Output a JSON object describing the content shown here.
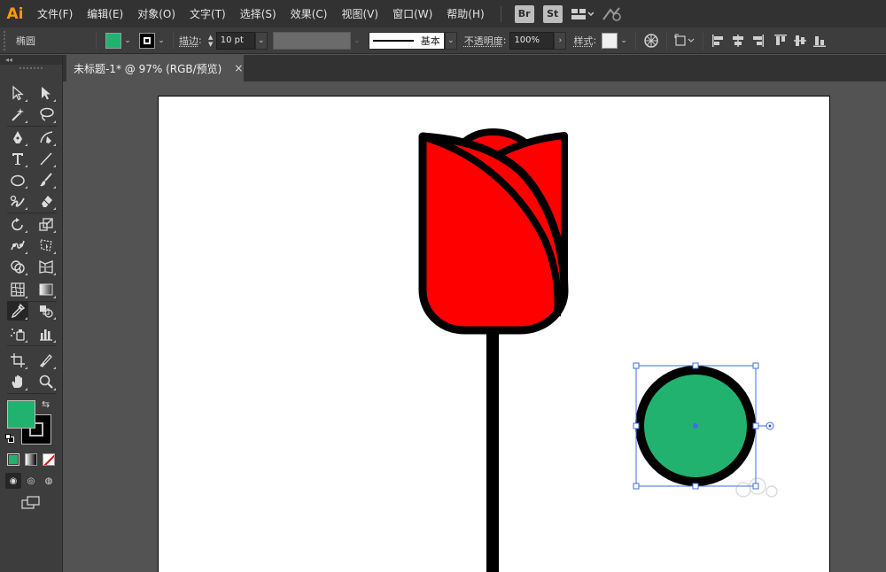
{
  "app": {
    "logo": "Ai"
  },
  "menubar": {
    "items": [
      "文件(F)",
      "编辑(E)",
      "对象(O)",
      "文字(T)",
      "选择(S)",
      "效果(C)",
      "视图(V)",
      "窗口(W)",
      "帮助(H)"
    ],
    "bridge": "Br",
    "stock": "St"
  },
  "controlbar": {
    "object_type": "椭圆",
    "fill_color": "#22b26f",
    "stroke_color": "#000000",
    "stroke_label": "描边",
    "stroke_weight": "10 pt",
    "profile_label": "基本",
    "opacity_label": "不透明度",
    "opacity_value": "100%",
    "style_label": "样式"
  },
  "toolbar": {
    "fill_color": "#22b26f",
    "stroke_color": "#000000",
    "tools": [
      [
        "selection-icon",
        "direct-selection-icon"
      ],
      [
        "magic-wand-icon",
        "lasso-icon"
      ],
      [
        "pen-icon",
        "curvature-icon"
      ],
      [
        "type-icon",
        "line-segment-icon"
      ],
      [
        "ellipse-icon",
        "paintbrush-icon"
      ],
      [
        "shaper-icon",
        "eraser-icon"
      ],
      [
        "rotate-icon",
        "scale-icon"
      ],
      [
        "puppet-warp-icon",
        "free-transform-icon"
      ],
      [
        "shape-builder-icon",
        "perspective-grid-icon"
      ],
      [
        "mesh-icon",
        "gradient-icon"
      ],
      [
        "eyedropper-icon",
        "blend-icon"
      ],
      [
        "symbol-sprayer-icon",
        "column-graph-icon"
      ],
      [
        "artboard-icon",
        "slice-icon"
      ],
      [
        "hand-icon",
        "zoom-icon"
      ]
    ]
  },
  "document": {
    "tab_title": "未标题-1* @ 97% (RGB/预览)",
    "close_glyph": "×"
  },
  "artwork": {
    "tulip_color": "#ff0000",
    "outline_color": "#000000",
    "circle_fill": "#22b26f",
    "selection_color": "#3d6ee0"
  }
}
